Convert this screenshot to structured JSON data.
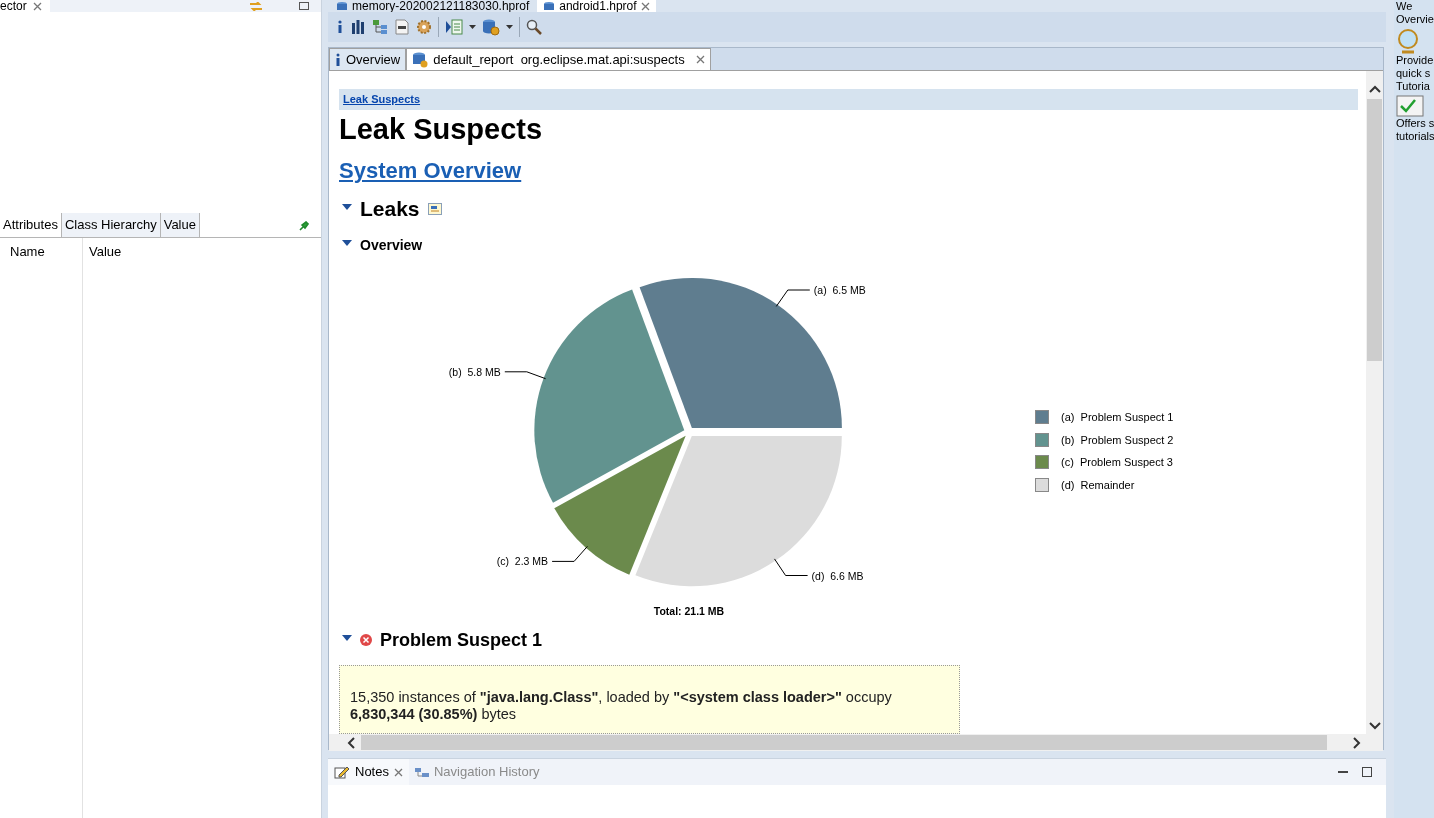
{
  "left_panel": {
    "view_tab": {
      "label": "ector"
    },
    "tabs": [
      {
        "label": "Attributes",
        "selected": true
      },
      {
        "label": "Class Hierarchy",
        "selected": false
      },
      {
        "label": "Value",
        "selected": false
      }
    ],
    "table": {
      "columns": [
        "Name",
        "Value"
      ]
    }
  },
  "editor_tabs": [
    {
      "label": "memory-202002121183030.hprof",
      "selected": false
    },
    {
      "label": "android1.hprof",
      "selected": true
    }
  ],
  "report_tabs": [
    {
      "label": "Overview",
      "selected": false,
      "closable": false
    },
    {
      "label": "default_report  org.eclipse.mat.api:suspects",
      "selected": true,
      "closable": true
    }
  ],
  "report": {
    "breadcrumb": "Leak Suspects",
    "title": "Leak Suspects",
    "overview_link": "System Overview",
    "leaks_heading": {
      "text": "Leaks",
      "expanded": true
    },
    "overview_heading": {
      "text": "Overview",
      "expanded": true
    },
    "chart_data": {
      "type": "pie",
      "title": "Total: 21.1 MB",
      "categories": [
        "(a)  Problem Suspect 1",
        "(b)  Problem Suspect 2",
        "(c)  Problem Suspect 3",
        "(d)  Remainder"
      ],
      "values": [
        6.5,
        5.8,
        2.3,
        6.6
      ],
      "colors": [
        "#5f7d8f",
        "#62938f",
        "#6b8a4c",
        "#dcdcdc"
      ],
      "legend": "right",
      "value_labels": [
        "(a)  6.5 MB",
        "(b)  5.8 MB",
        "(c)  2.3 MB",
        "(d)  6.6 MB"
      ]
    },
    "suspect_heading": {
      "text": "Problem Suspect 1",
      "expanded": true
    },
    "suspect_description": "15,350 instances of **\"java.lang.Class\"**, loaded by **\"<system class loader>\"** occupy **6,830,344 (30.85%)** bytes"
  },
  "bottom_panel": {
    "tabs": [
      {
        "label": "Notes",
        "selected": true
      },
      {
        "label": "Navigation History",
        "selected": false
      }
    ]
  },
  "side_strip": {
    "texts": [
      "We",
      "Overvie",
      "Provide",
      "quick s",
      "Tutoria",
      "Offers s",
      "tutorials"
    ]
  }
}
